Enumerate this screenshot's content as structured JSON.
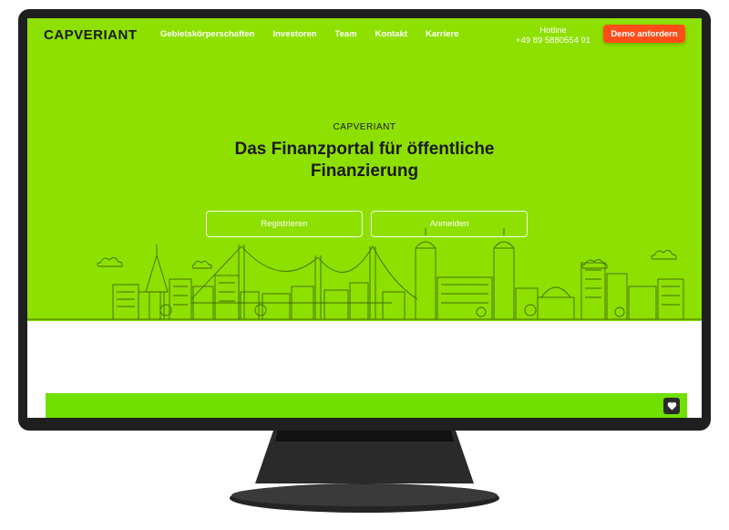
{
  "brand": {
    "name": "CAPVERIANT",
    "accent": "#8ee000",
    "cta_color": "#ff4d1a"
  },
  "nav": {
    "items": [
      "Gebietskörperschaften",
      "Investoren",
      "Team",
      "Kontakt",
      "Karriere"
    ],
    "hotline_label": "Hotline",
    "hotline_number": "+49 89 5880554 91",
    "demo_button": "Demo anfordern"
  },
  "hero": {
    "kicker": "CAPVERIANT",
    "title": "Das Finanzportal für öffentliche Finanzierung",
    "register_button": "Registrieren",
    "login_button": "Anmelden",
    "illustration": "city-skyline-line-art"
  },
  "footer_bar": {
    "icon": "heart-icon"
  }
}
